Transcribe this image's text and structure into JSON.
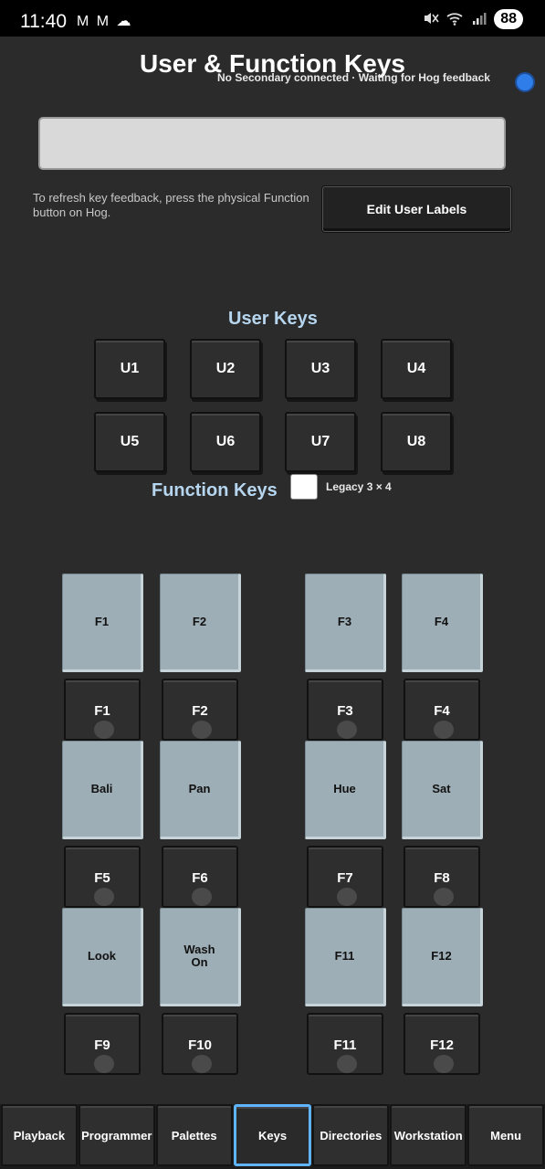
{
  "status_bar": {
    "time": "11:40",
    "left_icons": "M M ☁",
    "mute_icon": "🔇",
    "wifi_icon": "wifi-6-icon",
    "signal_icon": "signal-icon",
    "battery": "88"
  },
  "header": {
    "title": "User & Function Keys",
    "secondary_status": "No Secondary connected · Waiting for Hog feedback"
  },
  "hint_text": "To refresh key feedback, press the physical Function button on Hog.",
  "edit_button": "Edit User Labels",
  "user_keys": {
    "label": "User Keys",
    "keys": [
      "U1",
      "U2",
      "U3",
      "U4",
      "U5",
      "U6",
      "U7",
      "U8"
    ]
  },
  "function_keys": {
    "label": "Function Keys",
    "legacy_label": "Legacy 3 × 4",
    "labels": [
      "F1",
      "F2",
      "F3",
      "F4",
      "Bali",
      "Pan",
      "Hue",
      "Sat",
      "Look",
      "Wash On",
      "F11",
      "F12"
    ],
    "buttons": [
      "F1",
      "F2",
      "F3",
      "F4",
      "F5",
      "F6",
      "F7",
      "F8",
      "F9",
      "F10",
      "F11",
      "F12"
    ]
  },
  "nav": {
    "items": [
      "Playback",
      "Programmer",
      "Palettes",
      "Keys",
      "Directories",
      "Workstation",
      "Menu"
    ],
    "active": "Keys"
  },
  "colors": {
    "accent": "#5fb4ff",
    "connection_dot": "#2f7de8",
    "label_key": "#9eaeb6",
    "section_label": "#b6d6f0"
  }
}
